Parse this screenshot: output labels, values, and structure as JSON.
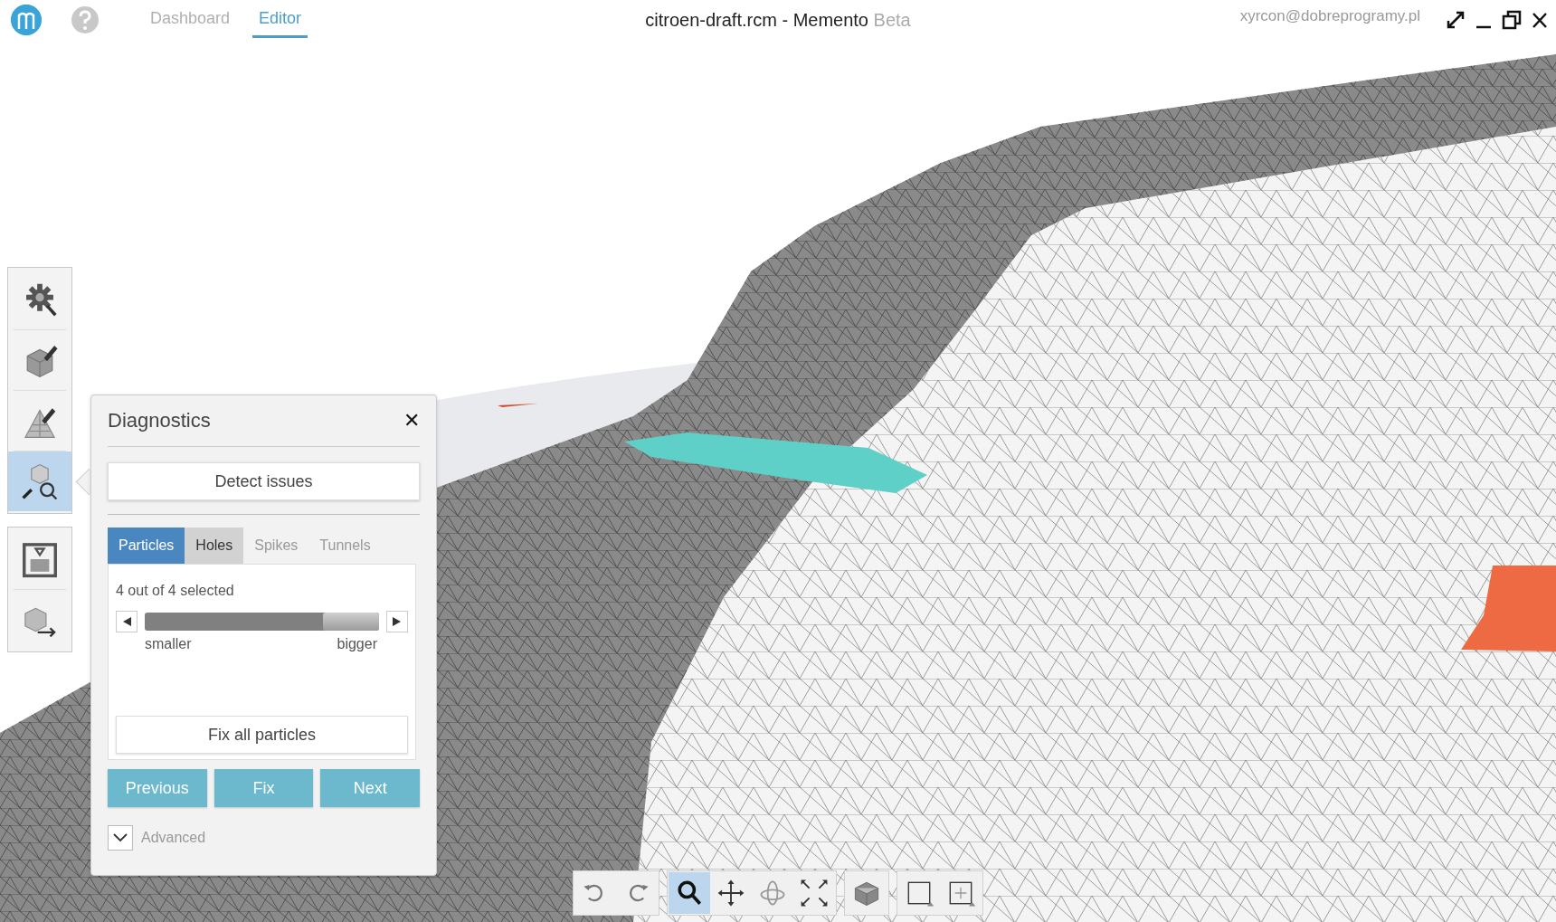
{
  "app_bar": {
    "nav": [
      {
        "label": "Dashboard",
        "selected": false
      },
      {
        "label": "Editor",
        "selected": true
      }
    ],
    "title": "citroen-draft.rcm - Memento",
    "title_suffix": "Beta",
    "user": "xyrcon@dobreprogramy.pl"
  },
  "left_toolbar": {
    "groups": [
      [
        {
          "kind": "settings",
          "selected": false
        },
        {
          "kind": "edit",
          "selected": false
        },
        {
          "kind": "sculpt",
          "selected": false
        },
        {
          "kind": "diagnostics",
          "selected": true
        }
      ],
      [
        {
          "kind": "print",
          "selected": false
        },
        {
          "kind": "export",
          "selected": false
        }
      ]
    ]
  },
  "diagnostics": {
    "title": "Diagnostics",
    "close": "✕",
    "detect_button": "Detect issues",
    "tabs": [
      {
        "label": "Particles",
        "selected": true,
        "disabled": false
      },
      {
        "label": "Holes",
        "selected": false,
        "disabled": false
      },
      {
        "label": "Spikes",
        "selected": false,
        "disabled": true
      },
      {
        "label": "Tunnels",
        "selected": false,
        "disabled": true
      }
    ],
    "summary": "4 out of 4 selected",
    "slider": {
      "level": 1,
      "min_label": "smaller",
      "max_label": "bigger"
    },
    "fix_all_button": "Fix all particles",
    "actions": [
      "Previous",
      "Fix",
      "Next"
    ],
    "advanced": {
      "label": "Advanced",
      "expanded": false
    }
  },
  "view_toolbar": {
    "groups": [
      [
        {
          "kind": "undo",
          "selected": false
        },
        {
          "kind": "redo",
          "selected": false
        }
      ],
      [
        {
          "kind": "zoom",
          "selected": true
        },
        {
          "kind": "pan",
          "selected": false
        },
        {
          "kind": "orbit",
          "selected": false
        },
        {
          "kind": "fit",
          "selected": false
        }
      ],
      [
        {
          "kind": "cube",
          "selected": false
        }
      ],
      [
        {
          "kind": "select",
          "selected": false
        },
        {
          "kind": "add",
          "selected": false
        }
      ]
    ]
  }
}
